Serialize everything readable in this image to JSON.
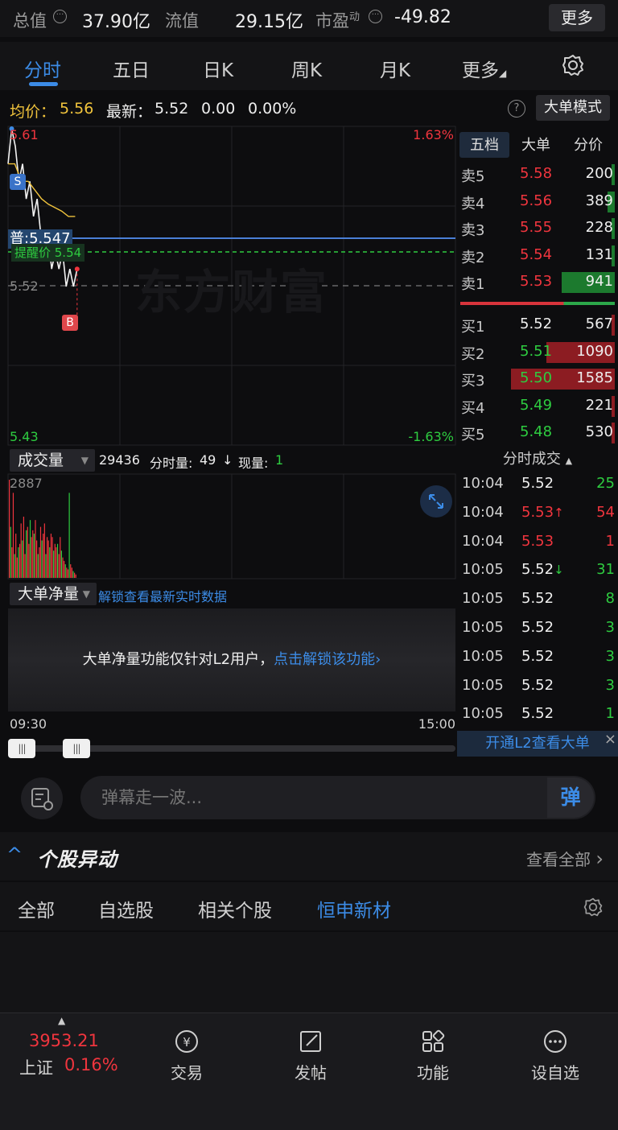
{
  "topbar": {
    "total_label": "总值",
    "total_value": "37.90亿",
    "float_label": "流值",
    "float_value": "29.15亿",
    "pe_label": "市盈",
    "pe_sup": "动",
    "pe_value": "-49.82",
    "more": "更多"
  },
  "tabs": [
    "分时",
    "五日",
    "日K",
    "周K",
    "月K",
    "更多"
  ],
  "avg": {
    "avg_label": "均价：",
    "avg_value": "5.56",
    "latest_label": "最新：",
    "latest_value": "5.52",
    "change": "0.00",
    "change_pct": "0.00%",
    "mode_button": "大单模式"
  },
  "chart_labels": {
    "high": "5.61",
    "high_pct": "1.63%",
    "low": "5.43",
    "low_pct": "-1.63%",
    "mid": "5.52",
    "cost_label": "普:5.547",
    "alert_label": "提醒价 5.54",
    "watermark": "东方财富",
    "marker_s": "S",
    "marker_b": "B",
    "vol_max": "2887"
  },
  "chart_data": {
    "type": "line",
    "x": [
      "09:30",
      "15:00"
    ],
    "ylim": [
      5.43,
      5.61
    ],
    "series": [
      {
        "values": [
          5.59,
          5.61,
          5.6,
          5.58,
          5.59,
          5.57,
          5.58,
          5.56,
          5.57,
          5.55,
          5.54,
          5.55,
          5.53,
          5.54,
          5.53,
          5.54,
          5.52,
          5.53,
          5.52,
          5.53
        ]
      },
      {
        "values": [
          5.59,
          5.59,
          5.58,
          5.58,
          5.575,
          5.57,
          5.567,
          5.565,
          5.563,
          5.56,
          5.56
        ]
      }
    ],
    "volumes": [
      2887,
      1500,
      900,
      2500,
      700,
      1300,
      600,
      900,
      1000,
      1600,
      1100,
      1800,
      700,
      1400,
      1500,
      1000,
      1700,
      1200,
      1400,
      1300,
      1700,
      1100,
      700,
      900,
      1500,
      1100,
      1300,
      1600,
      700,
      1200,
      1100,
      900,
      1300,
      1200,
      800,
      1000,
      900,
      1000,
      700,
      1200,
      800,
      600,
      500,
      400,
      300,
      250,
      2500,
      400,
      300,
      200,
      150,
      100
    ]
  },
  "volume": {
    "selector": "成交量",
    "total": "29436",
    "tick_label": "分时量:",
    "tick_value": "49",
    "tick_arrow": "↓",
    "now_label": "现量:",
    "now_value": "1"
  },
  "bignet": {
    "selector": "大单净量",
    "unlock_link": "解锁查看最新实时数据",
    "notice": "大单净量功能仅针对L2用户，",
    "notice_link": "点击解锁该功能"
  },
  "time_axis": {
    "start": "09:30",
    "end": "15:00"
  },
  "right_panel": {
    "tabs": [
      "五档",
      "大单",
      "分价"
    ],
    "sells": [
      {
        "label": "卖5",
        "price": "5.58",
        "vol": "200",
        "bar": 0.02
      },
      {
        "label": "卖4",
        "price": "5.56",
        "vol": "389",
        "bar": 0.05
      },
      {
        "label": "卖3",
        "price": "5.55",
        "vol": "228",
        "bar": 0.02
      },
      {
        "label": "卖2",
        "price": "5.54",
        "vol": "131",
        "bar": 0.01
      },
      {
        "label": "卖1",
        "price": "5.53",
        "vol": "941",
        "bar": 0.35
      }
    ],
    "buys": [
      {
        "label": "买1",
        "price": "5.52",
        "vol": "567",
        "bar": 0.02
      },
      {
        "label": "买2",
        "price": "5.51",
        "vol": "1090",
        "bar": 0.45
      },
      {
        "label": "买3",
        "price": "5.50",
        "vol": "1585",
        "bar": 0.68
      },
      {
        "label": "买4",
        "price": "5.49",
        "vol": "221",
        "bar": 0.02
      },
      {
        "label": "买5",
        "price": "5.48",
        "vol": "530",
        "bar": 0.02
      }
    ],
    "ticks_header": "分时成交",
    "ticks": [
      {
        "t": "10:04",
        "p": "5.52",
        "dir": "",
        "v": "25",
        "pc": "white",
        "vc": "green"
      },
      {
        "t": "10:04",
        "p": "5.53",
        "dir": "↑",
        "v": "54",
        "pc": "red",
        "vc": "red"
      },
      {
        "t": "10:04",
        "p": "5.53",
        "dir": "",
        "v": "1",
        "pc": "red",
        "vc": "red"
      },
      {
        "t": "10:05",
        "p": "5.52",
        "dir": "↓",
        "v": "31",
        "pc": "white",
        "vc": "green"
      },
      {
        "t": "10:05",
        "p": "5.52",
        "dir": "",
        "v": "8",
        "pc": "white",
        "vc": "green"
      },
      {
        "t": "10:05",
        "p": "5.52",
        "dir": "",
        "v": "3",
        "pc": "white",
        "vc": "green"
      },
      {
        "t": "10:05",
        "p": "5.52",
        "dir": "",
        "v": "3",
        "pc": "white",
        "vc": "green"
      },
      {
        "t": "10:05",
        "p": "5.52",
        "dir": "",
        "v": "3",
        "pc": "white",
        "vc": "green"
      },
      {
        "t": "10:05",
        "p": "5.52",
        "dir": "",
        "v": "1",
        "pc": "white",
        "vc": "green"
      }
    ],
    "l2_button": "开通L2查看大单",
    "l2_close": "×"
  },
  "danmu": {
    "placeholder": "弹幕走一波...",
    "send": "弹"
  },
  "anomaly": {
    "title": "个股异动",
    "view_all": "查看全部",
    "chevron": "^",
    "view_all_arrow": "›"
  },
  "filter_tabs": [
    "全部",
    "自选股",
    "相关个股",
    "恒申新材"
  ],
  "bottom": {
    "index_value": "3953.21",
    "index_name": "上证",
    "index_pct": "0.16%",
    "items": [
      "交易",
      "发帖",
      "功能",
      "设自选"
    ]
  },
  "colors": {
    "red": "#f0353e",
    "green": "#2ecc40",
    "blue": "#3c8ce7",
    "yellow": "#f0c33c",
    "bg": "#0d0d0f"
  }
}
